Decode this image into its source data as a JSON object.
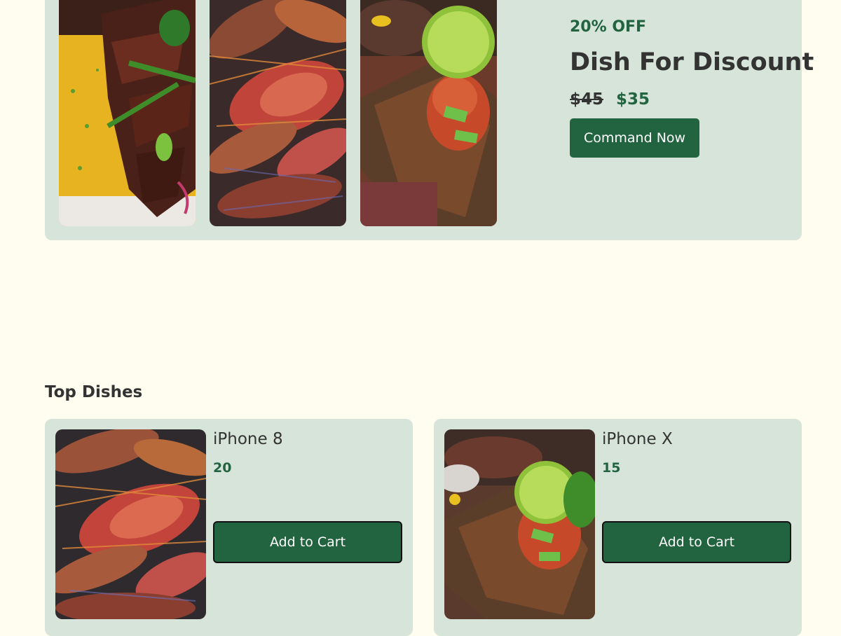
{
  "promo": {
    "discount": "20% OFF",
    "title": "Dish For Discount",
    "old_price": "$45",
    "new_price": "$35",
    "cta_label": "Command Now"
  },
  "top_dishes": {
    "title": "Top Dishes",
    "items": [
      {
        "name": "iPhone 8",
        "price": "20",
        "button": "Add to Cart"
      },
      {
        "name": "iPhone X",
        "price": "15",
        "button": "Add to Cart"
      }
    ]
  },
  "colors": {
    "accent": "#236440",
    "card_bg": "#d6e4d9",
    "page_bg": "#fffcf0"
  }
}
